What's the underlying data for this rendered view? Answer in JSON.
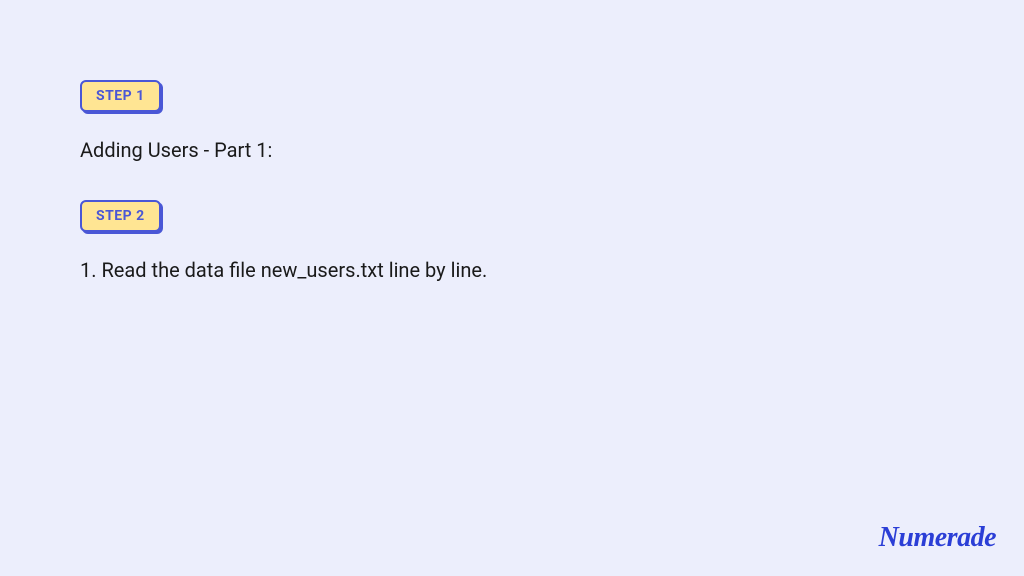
{
  "steps": [
    {
      "badge": "STEP 1",
      "text": "Adding Users - Part 1:"
    },
    {
      "badge": "STEP 2",
      "text": "1. Read the data file new_users.txt line by line."
    }
  ],
  "brand": "Numerade"
}
